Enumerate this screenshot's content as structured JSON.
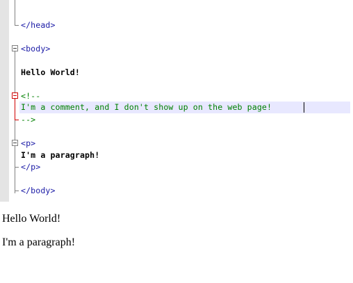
{
  "editor": {
    "lines": {
      "close_head": "</head>",
      "open_body": "<body>",
      "hello": "Hello World!",
      "comment_open": "<!--",
      "comment_text": "I'm a comment, and I don't show up on the web page!",
      "comment_close": "-->",
      "open_p": "<p>",
      "paragraph": "I'm a paragraph!",
      "close_p": "</p>",
      "close_body": "</body>"
    },
    "colors": {
      "tag": "#1a1aa6",
      "comment": "#008000",
      "text": "#000000",
      "current_line": "#e8e8ff",
      "gutter": "#e4e4e4",
      "fold_marker_active": "#d00000"
    },
    "icons": [
      "fold-collapse-icon"
    ]
  },
  "preview": {
    "hello": "Hello World!",
    "paragraph": "I'm a paragraph!"
  }
}
